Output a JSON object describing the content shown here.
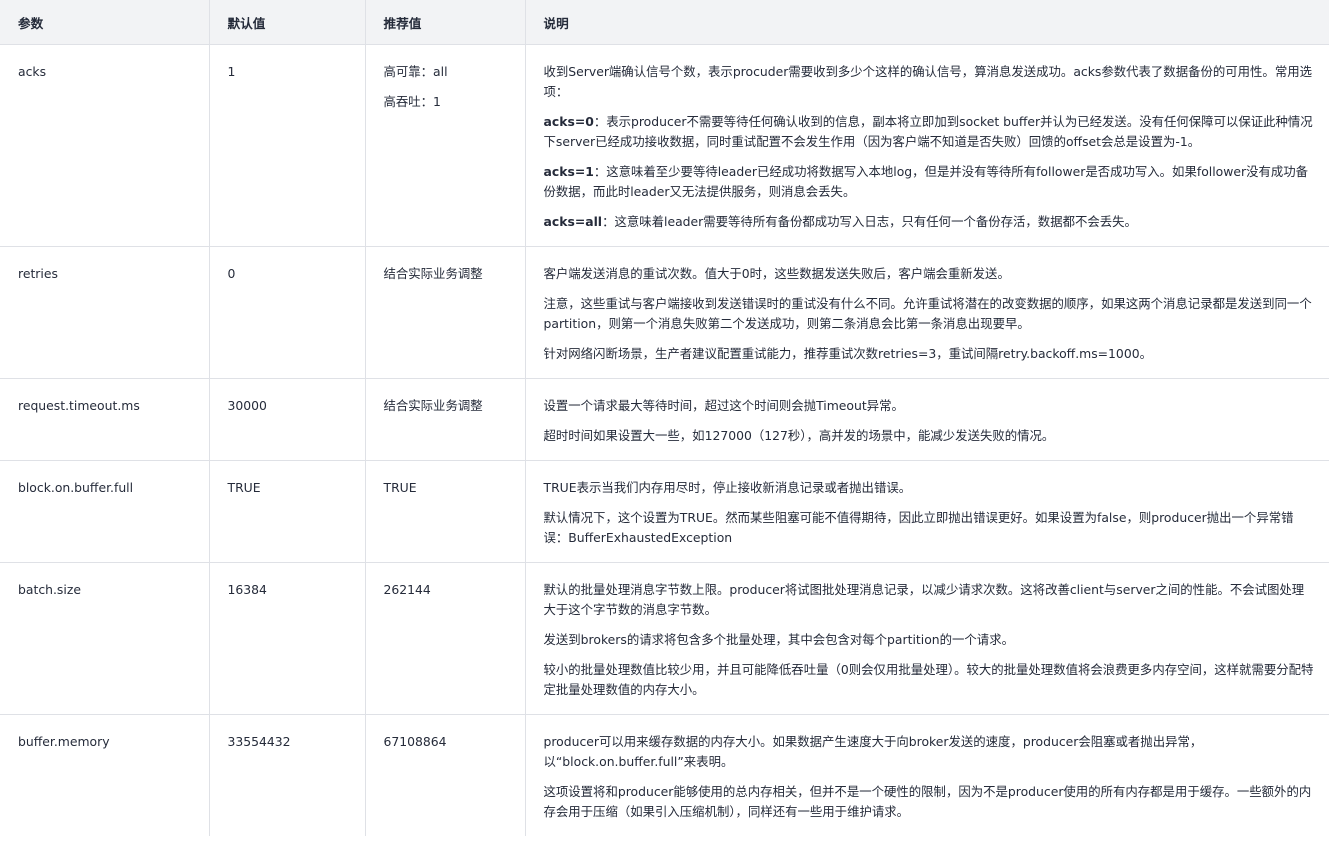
{
  "headers": [
    "参数",
    "默认值",
    "推荐值",
    "说明"
  ],
  "rows": [
    {
      "param": "acks",
      "default": "1",
      "recommended": [
        "高可靠：all",
        "高吞吐：1"
      ],
      "desc": [
        {
          "lead": "",
          "text": "收到Server端确认信号个数，表示procuder需要收到多少个这样的确认信号，算消息发送成功。acks参数代表了数据备份的可用性。常用选项："
        },
        {
          "lead": "acks=0",
          "text": "：表示producer不需要等待任何确认收到的信息，副本将立即加到socket buffer并认为已经发送。没有任何保障可以保证此种情况下server已经成功接收数据，同时重试配置不会发生作用（因为客户端不知道是否失败）回馈的offset会总是设置为-1。"
        },
        {
          "lead": "acks=1",
          "text": "：这意味着至少要等待leader已经成功将数据写入本地log，但是并没有等待所有follower是否成功写入。如果follower没有成功备份数据，而此时leader又无法提供服务，则消息会丢失。"
        },
        {
          "lead": "acks=all",
          "text": "：这意味着leader需要等待所有备份都成功写入日志，只有任何一个备份存活，数据都不会丢失。"
        }
      ]
    },
    {
      "param": "retries",
      "default": "0",
      "recommended": [
        "结合实际业务调整"
      ],
      "desc": [
        {
          "lead": "",
          "text": "客户端发送消息的重试次数。值大于0时，这些数据发送失败后，客户端会重新发送。"
        },
        {
          "lead": "",
          "text": "注意，这些重试与客户端接收到发送错误时的重试没有什么不同。允许重试将潜在的改变数据的顺序，如果这两个消息记录都是发送到同一个partition，则第一个消息失败第二个发送成功，则第二条消息会比第一条消息出现要早。"
        },
        {
          "lead": "",
          "text": "针对网络闪断场景，生产者建议配置重试能力，推荐重试次数retries=3，重试间隔retry.backoff.ms=1000。"
        }
      ]
    },
    {
      "param": "request.timeout.ms",
      "default": "30000",
      "recommended": [
        "结合实际业务调整"
      ],
      "desc": [
        {
          "lead": "",
          "text": "设置一个请求最大等待时间，超过这个时间则会抛Timeout异常。"
        },
        {
          "lead": "",
          "text": "超时时间如果设置大一些，如127000（127秒），高并发的场景中，能减少发送失败的情况。"
        }
      ]
    },
    {
      "param": "block.on.buffer.full",
      "default": "TRUE",
      "recommended": [
        "TRUE"
      ],
      "desc": [
        {
          "lead": "",
          "text": "TRUE表示当我们内存用尽时，停止接收新消息记录或者抛出错误。"
        },
        {
          "lead": "",
          "text": "默认情况下，这个设置为TRUE。然而某些阻塞可能不值得期待，因此立即抛出错误更好。如果设置为false，则producer抛出一个异常错误：BufferExhaustedException"
        }
      ]
    },
    {
      "param": "batch.size",
      "default": "16384",
      "recommended": [
        "262144"
      ],
      "desc": [
        {
          "lead": "",
          "text": "默认的批量处理消息字节数上限。producer将试图批处理消息记录，以减少请求次数。这将改善client与server之间的性能。不会试图处理大于这个字节数的消息字节数。"
        },
        {
          "lead": "",
          "text": "发送到brokers的请求将包含多个批量处理，其中会包含对每个partition的一个请求。"
        },
        {
          "lead": "",
          "text": "较小的批量处理数值比较少用，并且可能降低吞吐量（0则会仅用批量处理）。较大的批量处理数值将会浪费更多内存空间，这样就需要分配特定批量处理数值的内存大小。"
        }
      ]
    },
    {
      "param": "buffer.memory",
      "default": "33554432",
      "recommended": [
        "67108864"
      ],
      "desc": [
        {
          "lead": "",
          "text": "producer可以用来缓存数据的内存大小。如果数据产生速度大于向broker发送的速度，producer会阻塞或者抛出异常，以“block.on.buffer.full”来表明。"
        },
        {
          "lead": "",
          "text": "这项设置将和producer能够使用的总内存相关，但并不是一个硬性的限制，因为不是producer使用的所有内存都是用于缓存。一些额外的内存会用于压缩（如果引入压缩机制），同样还有一些用于维护请求。"
        }
      ]
    }
  ]
}
